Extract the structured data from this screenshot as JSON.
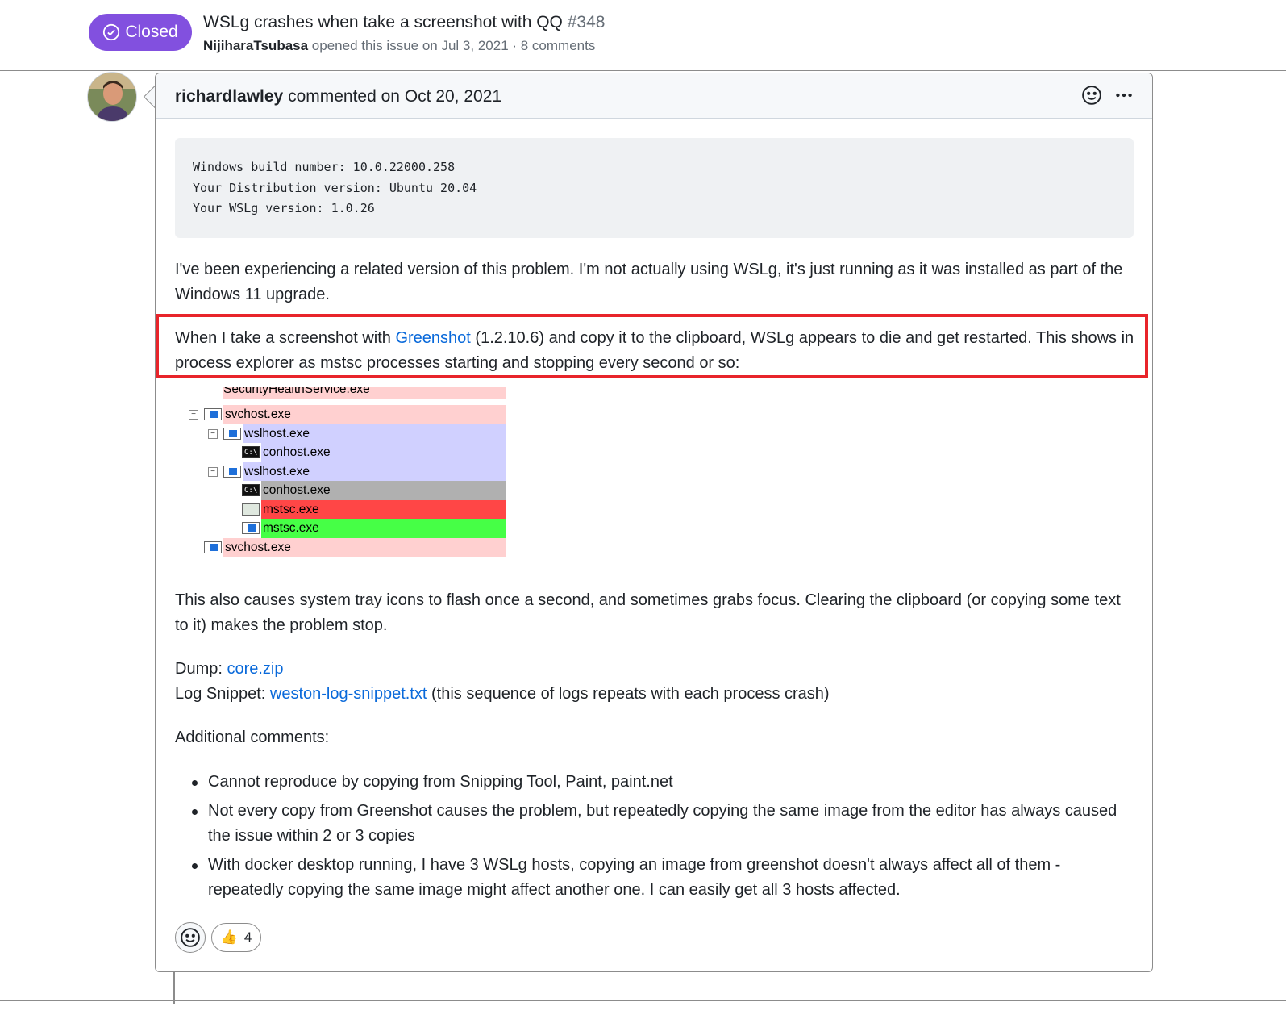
{
  "issue": {
    "state": "Closed",
    "title": "WSLg crashes when take a screenshot with QQ",
    "number": "#348",
    "author": "NijiharaTsubasa",
    "meta": " opened this issue on Jul 3, 2021 · 8 comments"
  },
  "comment": {
    "author": "richardlawley",
    "action": " commented on Oct 20, 2021",
    "code_lines": [
      "Windows build number: 10.0.22000.258",
      "Your Distribution version: Ubuntu 20.04",
      "Your WSLg version: 1.0.26"
    ],
    "para1": "I've been experiencing a related version of this problem. I'm not actually using WSLg, it's just running as it was installed as part of the Windows 11 upgrade.",
    "para2_before": "When I take a screenshot with ",
    "para2_link": "Greenshot",
    "para2_after": " (1.2.10.6) and copy it to the clipboard, WSLg appears to die and get restarted. This shows in process explorer as mstsc processes starting and stopping every second or so:",
    "process_rows": [
      {
        "name": "SecurityHealthService.exe",
        "color": "#ffd0d0"
      },
      {
        "name": "svchost.exe",
        "color": "#ffd0d0"
      },
      {
        "name": "wslhost.exe",
        "color": "#d0d0ff"
      },
      {
        "name": "conhost.exe",
        "color": "#d0d0ff"
      },
      {
        "name": "wslhost.exe",
        "color": "#d0d0ff"
      },
      {
        "name": "conhost.exe",
        "color": "#b0b0b0"
      },
      {
        "name": "mstsc.exe",
        "color": "#ff4646"
      },
      {
        "name": "mstsc.exe",
        "color": "#46ff46"
      },
      {
        "name": "svchost.exe",
        "color": "#ffd0d0"
      }
    ],
    "para3": "This also causes system tray icons to flash once a second, and sometimes grabs focus. Clearing the clipboard (or copying some text to it) makes the problem stop.",
    "dump_label": "Dump: ",
    "dump_link": "core.zip",
    "log_label": "Log Snippet: ",
    "log_link": "weston-log-snippet.txt",
    "log_after": " (this sequence of logs repeats with each process crash)",
    "additional": "Additional comments:",
    "bullets": [
      "Cannot reproduce by copying from Snipping Tool, Paint, paint.net",
      "Not every copy from Greenshot causes the problem, but repeatedly copying the same image from the editor has always caused the issue within 2 or 3 copies",
      "With docker desktop running, I have 3 WSLg hosts, copying an image from greenshot doesn't always affect all of them - repeatedly copying the same image might affect another one. I can easily get all 3 hosts affected."
    ],
    "reaction_emoji": "👍",
    "reaction_count": "4"
  },
  "colors": {
    "closed_badge": "#8250df",
    "link": "#0969da",
    "highlight_border": "#e8242a"
  },
  "icons": [
    "check-circle-icon",
    "smiley-icon",
    "kebab-icon",
    "thumbs-up-icon"
  ]
}
